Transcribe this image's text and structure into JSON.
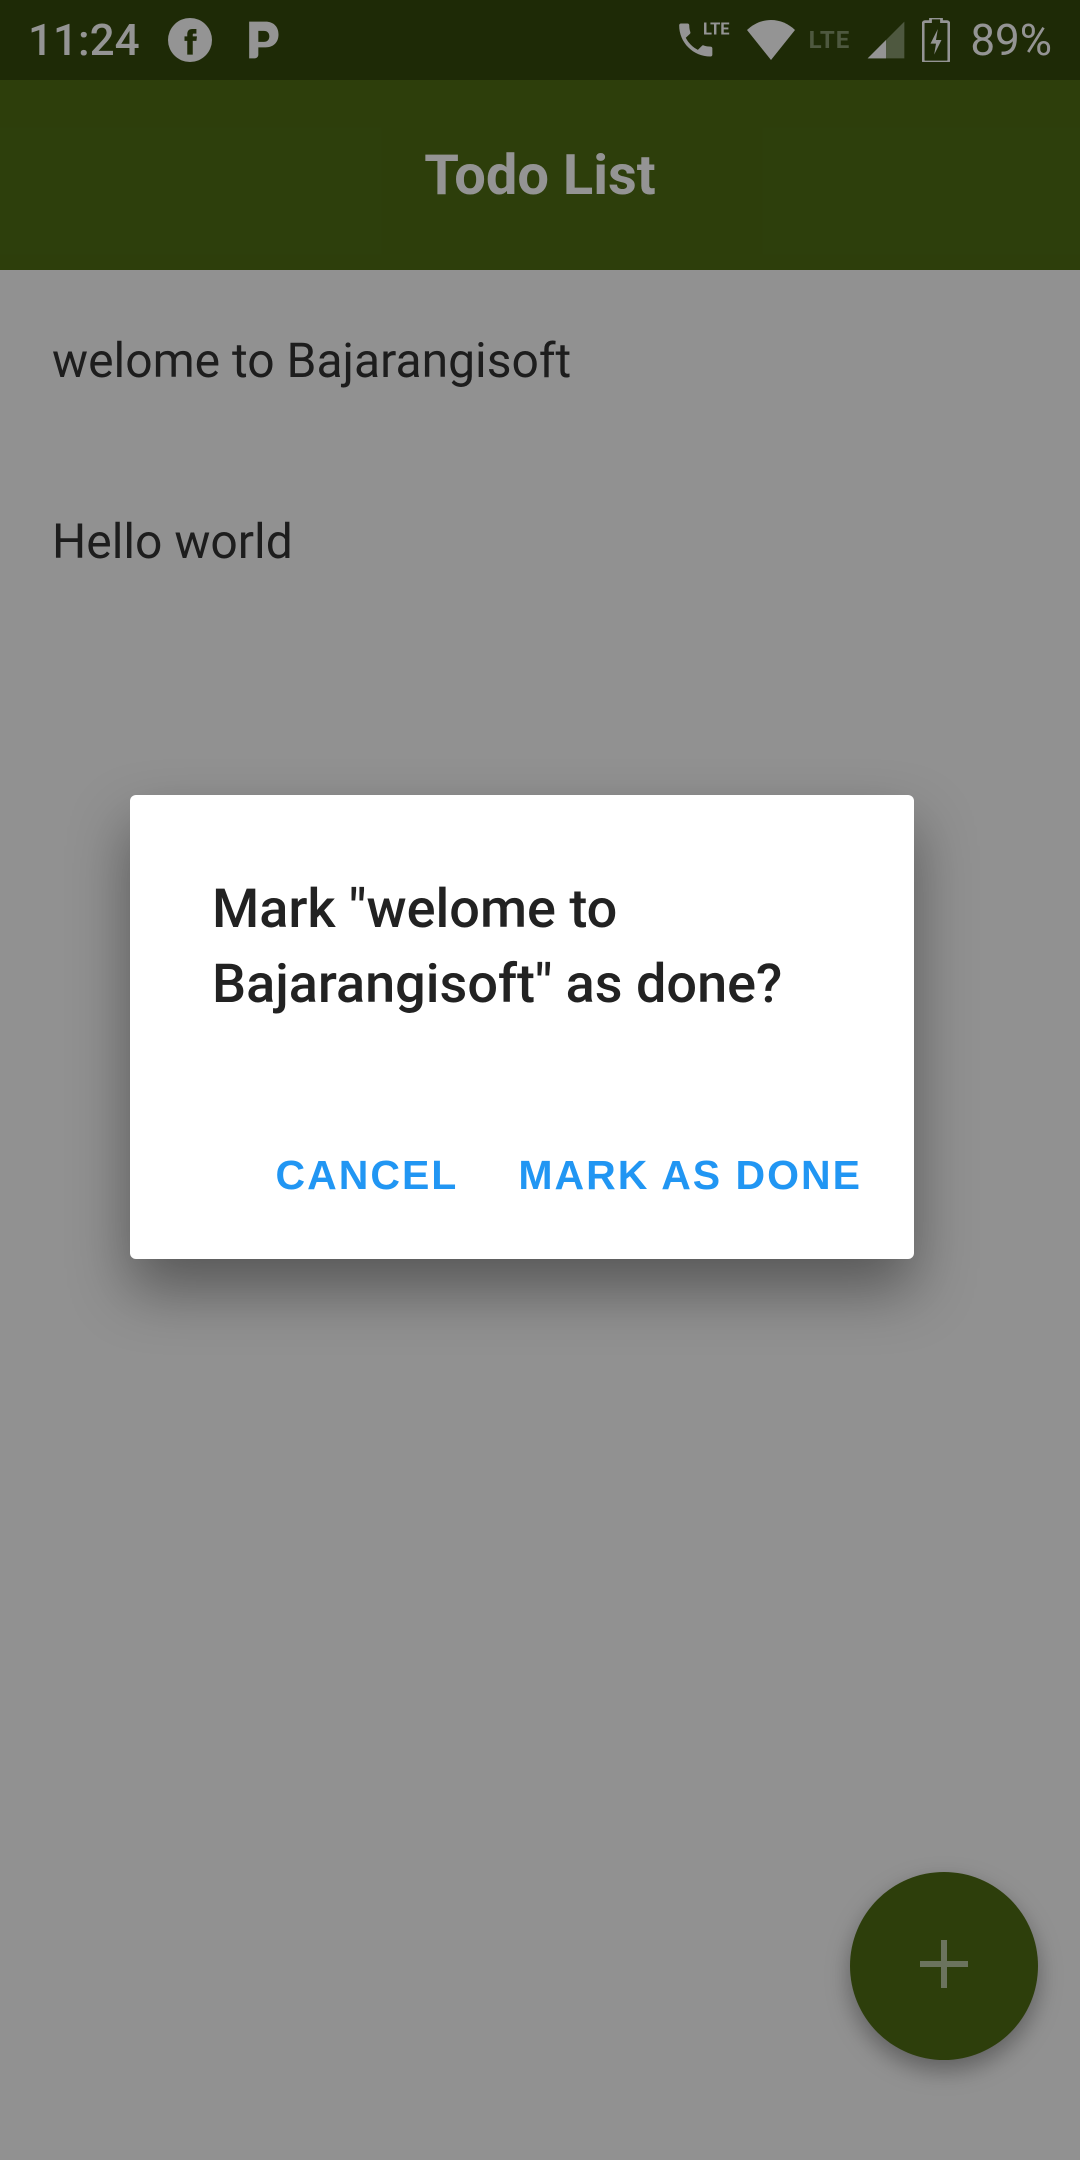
{
  "status": {
    "time": "11:24",
    "battery": "89%",
    "lte1": "LTE",
    "lte2": "LTE"
  },
  "appbar": {
    "title": "Todo List"
  },
  "list": {
    "items": [
      {
        "label": "welome to Bajarangisoft"
      },
      {
        "label": "Hello world"
      }
    ]
  },
  "dialog": {
    "title": "Mark \"welome to Bajarangisoft\" as done?",
    "cancel_label": "CANCEL",
    "confirm_label": "MARK AS DONE"
  },
  "fab": {
    "icon": "plus-icon"
  }
}
